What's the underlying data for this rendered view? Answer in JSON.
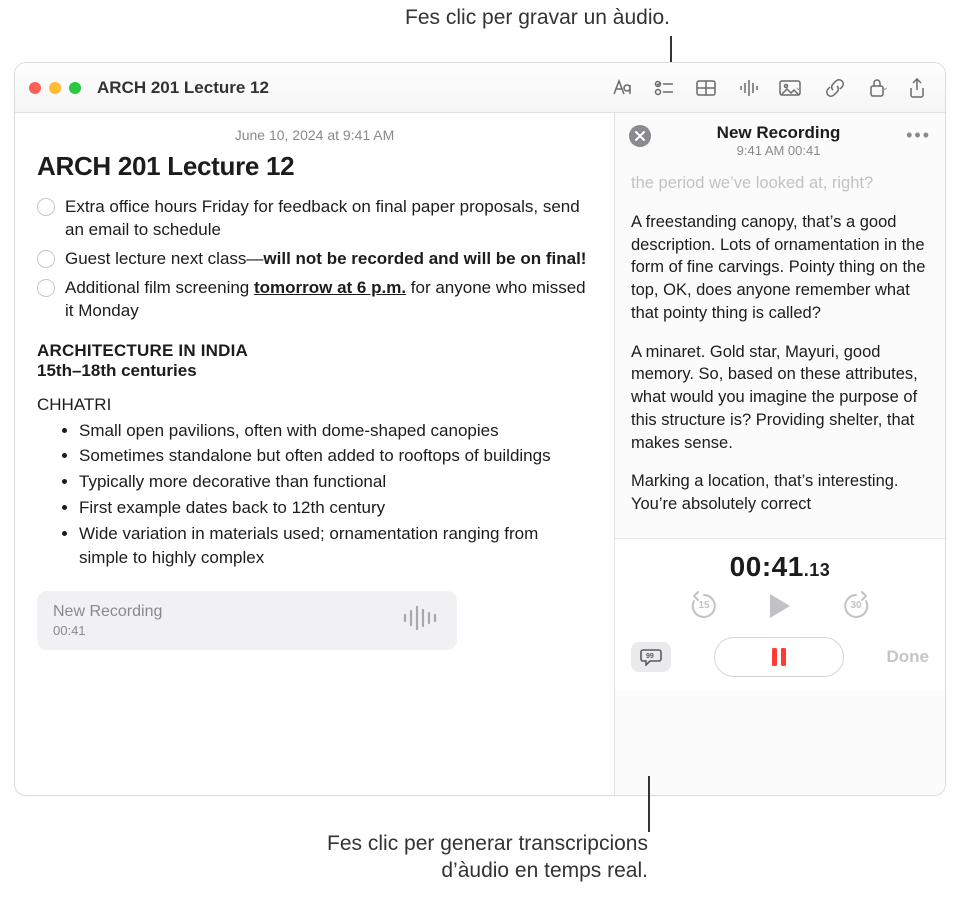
{
  "callouts": {
    "top": "Fes clic per gravar un àudio.",
    "bottom_l1": "Fes clic per generar transcripcions",
    "bottom_l2": "d’àudio en temps real."
  },
  "window": {
    "title": "ARCH 201 Lecture 12"
  },
  "note": {
    "date": "June 10, 2024 at 9:41 AM",
    "heading": "ARCH 201 Lecture 12",
    "checks": [
      "Extra office hours Friday for feedback on final paper proposals, send an email to schedule"
    ],
    "check2_a": "Guest lecture next class—",
    "check2_b": "will not be recorded and will be on final!",
    "check3_a": "Additional film screening ",
    "check3_b": "tomorrow at 6 p.m.",
    "check3_c": " for anyone who missed it Monday",
    "sub1": "ARCHITECTURE IN INDIA",
    "sub2": "15th–18th centuries",
    "sec": "CHHATRI",
    "bullets": [
      "Small open pavilions, often with dome-shaped canopies",
      "Sometimes standalone but often added to rooftops of buildings",
      "Typically more decorative than functional",
      "First example dates back to 12th century",
      "Wide variation in materials used; ornamentation ranging from simple to highly complex"
    ],
    "chip_title": "New Recording",
    "chip_time": "00:41"
  },
  "side": {
    "title": "New Recording",
    "sub": "9:41 AM 00:41",
    "faded": "the period we’ve looked at, right?",
    "p1": "A freestanding canopy, that’s a good description. Lots of ornamentation in the form of fine carvings. Pointy thing on the top, OK, does anyone remember what that pointy thing is called?",
    "p2": "A minaret. Gold star, Mayuri, good memory. So, based on these attributes, what would you imagine the purpose of this structure is? Providing shelter, that makes sense.",
    "p3": "Marking a location, that’s interesting. You’re absolutely correct",
    "timer_main": "00:41",
    "timer_ms": ".13",
    "skip_back": "15",
    "skip_fwd": "30",
    "done": "Done"
  }
}
